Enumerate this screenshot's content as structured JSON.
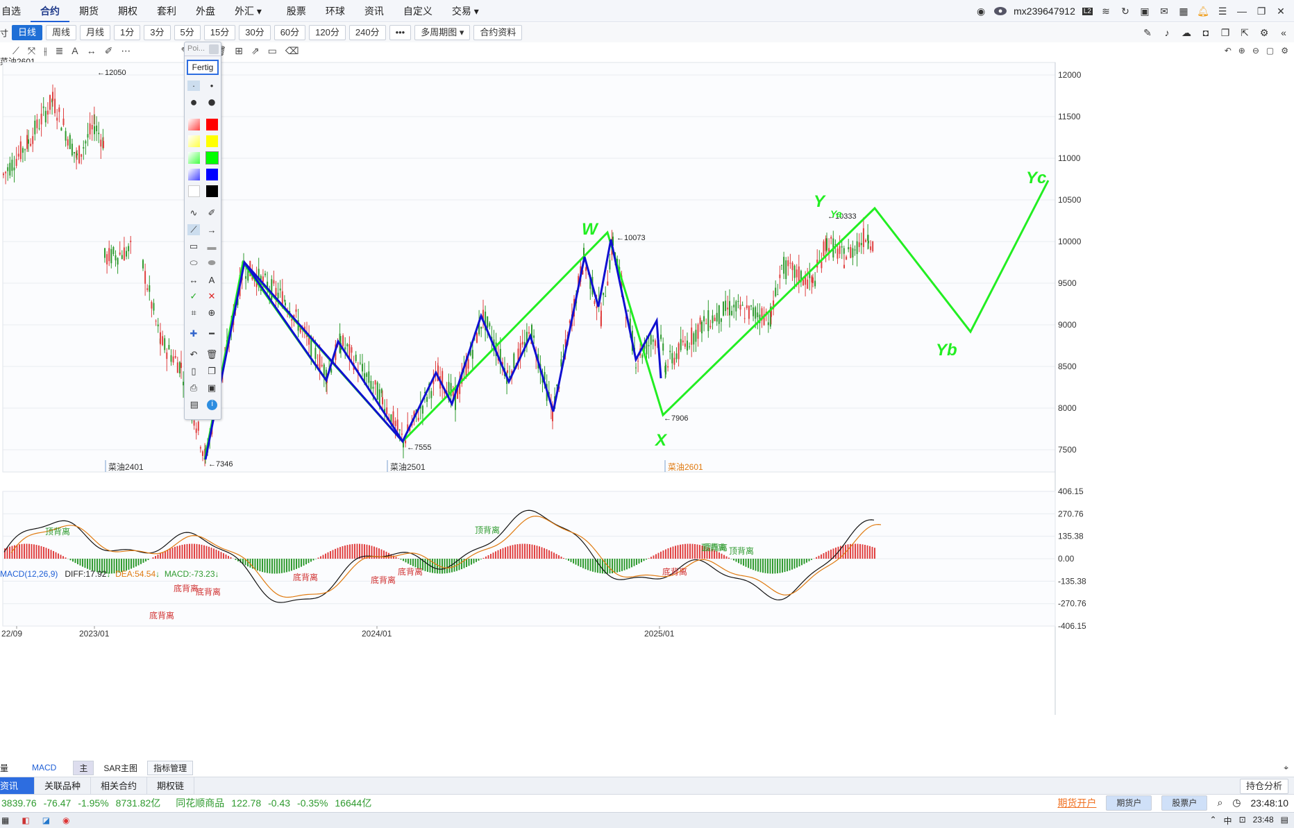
{
  "menu": {
    "items": [
      "自选",
      "合约",
      "期货",
      "期权",
      "套利",
      "外盘",
      "外汇 ▾",
      "股票",
      "环球",
      "资讯",
      "自定义",
      "交易 ▾"
    ],
    "active_index": 1
  },
  "user": {
    "name": "mx239647912",
    "level": "L2"
  },
  "periods": {
    "items": [
      "日线",
      "周线",
      "月线",
      "1分",
      "3分",
      "5分",
      "15分",
      "30分",
      "60分",
      "120分",
      "240分",
      "•••",
      "多周期图 ▾",
      "合约资料"
    ],
    "active_index": 0
  },
  "symbol_label": "菜油2601",
  "draw_panel": {
    "header": "Poi...",
    "done_label": "Fertig",
    "colors": [
      "#ff0000",
      "#ffff00",
      "#00ff00",
      "#0000ff",
      "#000000"
    ]
  },
  "price_axis": {
    "ticks": [
      "12000",
      "11500",
      "11000",
      "10500",
      "10000",
      "9500",
      "9000",
      "8500",
      "8000",
      "7500"
    ]
  },
  "price_labels": {
    "high1": "12050",
    "low1": "7346",
    "low2": "7555",
    "high2": "10073",
    "low3": "7906",
    "high3": "10333"
  },
  "contract_labels": [
    "菜油2401",
    "菜油2501",
    "菜油2601"
  ],
  "wave_labels": [
    "W",
    "X",
    "Y",
    "Ya",
    "Yb",
    "Yc"
  ],
  "macd": {
    "title": "MACD(12,26,9)",
    "diff": "DIFF:17.92",
    "dea": "DEA:54.54",
    "macd": "MACD:-73.23",
    "axis": [
      "406.15",
      "270.76",
      "135.38",
      "0.00",
      "-135.38",
      "-270.76",
      "-406.15"
    ],
    "annotations": [
      "顶背离",
      "顶背离",
      "顶背离",
      "顶背离",
      "顶背离",
      "底背离",
      "底背离",
      "底背离",
      "底背离",
      "底背离",
      "底背离",
      "底背离"
    ]
  },
  "time_axis": [
    "22/09",
    "2023/01",
    "2024/01",
    "2025/01"
  ],
  "bottom_tabs": [
    "量",
    "MACD",
    "主",
    "SAR主图",
    "指标管理"
  ],
  "info_tabs": [
    "资讯",
    "关联品种",
    "相关合约",
    "期权链"
  ],
  "hold_analysis": "持仓分析",
  "status": {
    "idx1_value": "3839.76",
    "idx1_chg": "-76.47",
    "idx1_pct": "-1.95%",
    "idx1_amt": "8731.82亿",
    "idx2_name": "同花顺商品",
    "idx2_value": "122.78",
    "idx2_chg": "-0.43",
    "idx2_pct": "-0.35%",
    "idx2_amt": "16644亿",
    "open_futures": "期货开户",
    "futures_acct": "期货户",
    "stock_acct": "股票户",
    "time": "23:48:10"
  },
  "taskbar": {
    "ime": "中",
    "time": "23:48"
  },
  "colors": {
    "up": "#e04040",
    "down": "#2e9a2e",
    "accent": "#2d6de0",
    "green_draw": "#22ee22",
    "blue_draw": "#1010d0"
  }
}
